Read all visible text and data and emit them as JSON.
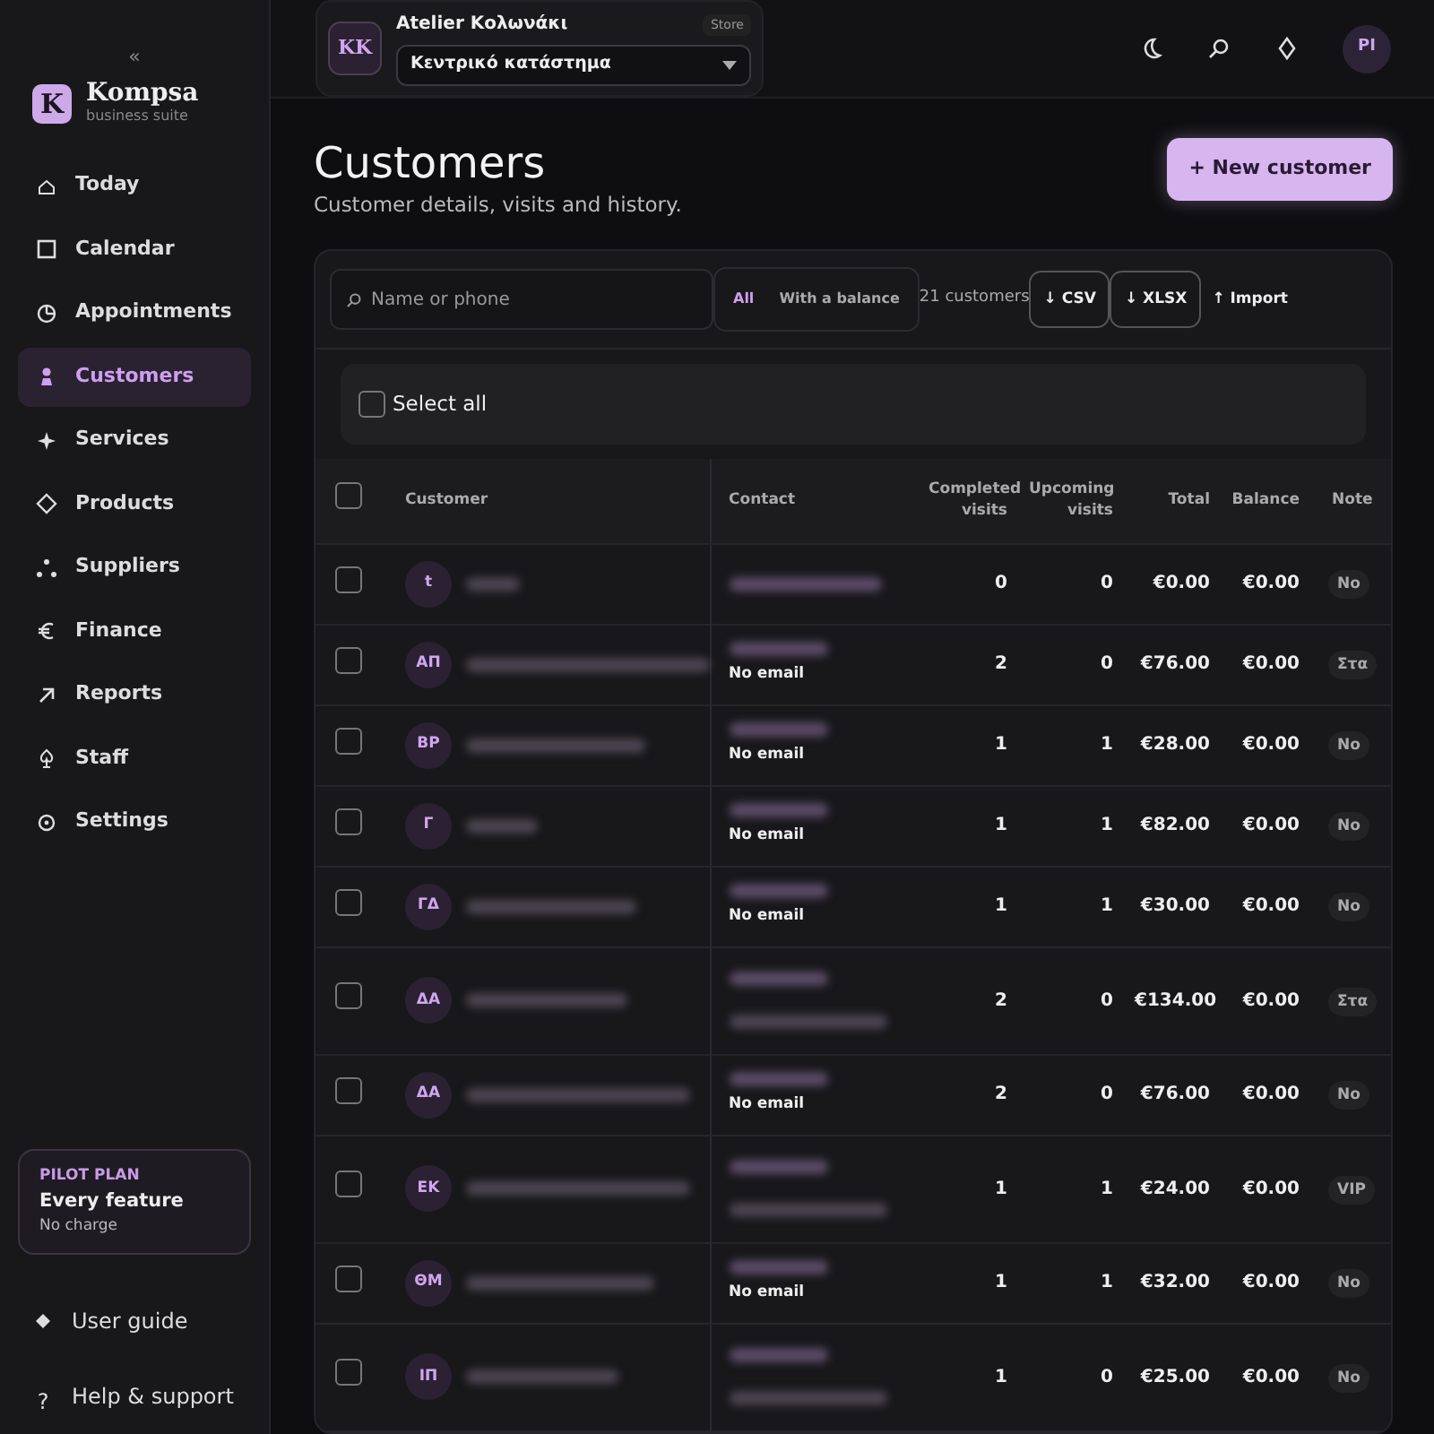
{
  "sidebar": {
    "collapse": "«",
    "brand": {
      "mark": "K",
      "name": "Kompsa",
      "tagline": "business suite"
    },
    "items": [
      {
        "label": "Today",
        "selected": false
      },
      {
        "label": "Calendar",
        "selected": false
      },
      {
        "label": "Appointments",
        "selected": false
      },
      {
        "label": "Customers",
        "selected": true
      },
      {
        "label": "Services",
        "selected": false
      },
      {
        "label": "Products",
        "selected": false
      },
      {
        "label": "Suppliers",
        "selected": false
      },
      {
        "label": "Finance",
        "selected": false
      },
      {
        "label": "Reports",
        "selected": false
      },
      {
        "label": "Staff",
        "selected": false
      },
      {
        "label": "Settings",
        "selected": false
      }
    ],
    "plan": {
      "label": "PILOT PLAN",
      "title": "Every feature",
      "note": "No charge"
    },
    "links": [
      {
        "label": "User guide"
      },
      {
        "label": "Help & support",
        "glyph": "?"
      }
    ]
  },
  "topbar": {
    "store": {
      "initials": "KK",
      "name": "Atelier Κολωνάκι",
      "badge": "Store",
      "location": "Κεντρικό κατάστημα"
    },
    "avatar": "PI"
  },
  "page": {
    "title": "Customers",
    "subtitle": "Customer details, visits and history.",
    "new_button": "+ New customer"
  },
  "toolbar": {
    "search": {
      "placeholder": "Name or phone"
    },
    "filters": [
      {
        "label": "All",
        "selected": true
      },
      {
        "label": "With a balance",
        "selected": false
      }
    ],
    "count": "21 customers",
    "exports": [
      "↓ CSV",
      "↓ XLSX"
    ],
    "import": "↑ Import"
  },
  "select_all": {
    "label": "Select all",
    "checked": false
  },
  "table": {
    "header_checked": false,
    "columns": [
      "Customer",
      "Contact",
      "Completed visits",
      "Upcoming visits",
      "Total",
      "Balance",
      "Note"
    ],
    "rows": [
      {
        "initials": "t",
        "checked": false,
        "email": null,
        "email_redacted": false,
        "completed": "0",
        "upcoming": "0",
        "total": "€0.00",
        "balance": "€0.00",
        "note": "No"
      },
      {
        "initials": "ΑΠ",
        "checked": false,
        "email": "No email",
        "email_redacted": false,
        "completed": "2",
        "upcoming": "0",
        "total": "€76.00",
        "balance": "€0.00",
        "note": "Στα"
      },
      {
        "initials": "ΒΡ",
        "checked": false,
        "email": "No email",
        "email_redacted": false,
        "completed": "1",
        "upcoming": "1",
        "total": "€28.00",
        "balance": "€0.00",
        "note": "No"
      },
      {
        "initials": "Γ",
        "checked": false,
        "email": "No email",
        "email_redacted": false,
        "completed": "1",
        "upcoming": "1",
        "total": "€82.00",
        "balance": "€0.00",
        "note": "No"
      },
      {
        "initials": "ΓΔ",
        "checked": false,
        "email": "No email",
        "email_redacted": false,
        "completed": "1",
        "upcoming": "1",
        "total": "€30.00",
        "balance": "€0.00",
        "note": "No"
      },
      {
        "initials": "ΔΑ",
        "checked": false,
        "email": null,
        "email_redacted": true,
        "completed": "2",
        "upcoming": "0",
        "total": "€134.00",
        "balance": "€0.00",
        "note": "Στα"
      },
      {
        "initials": "ΔΑ",
        "checked": false,
        "email": "No email",
        "email_redacted": false,
        "completed": "2",
        "upcoming": "0",
        "total": "€76.00",
        "balance": "€0.00",
        "note": "No"
      },
      {
        "initials": "ΕΚ",
        "checked": false,
        "email": null,
        "email_redacted": true,
        "completed": "1",
        "upcoming": "1",
        "total": "€24.00",
        "balance": "€0.00",
        "note": "VIP"
      },
      {
        "initials": "ΘΜ",
        "checked": false,
        "email": "No email",
        "email_redacted": false,
        "completed": "1",
        "upcoming": "1",
        "total": "€32.00",
        "balance": "€0.00",
        "note": "No"
      },
      {
        "initials": "ΙΠ",
        "checked": false,
        "email": null,
        "email_redacted": true,
        "completed": "1",
        "upcoming": "0",
        "total": "€25.00",
        "balance": "€0.00",
        "note": "No"
      }
    ]
  }
}
